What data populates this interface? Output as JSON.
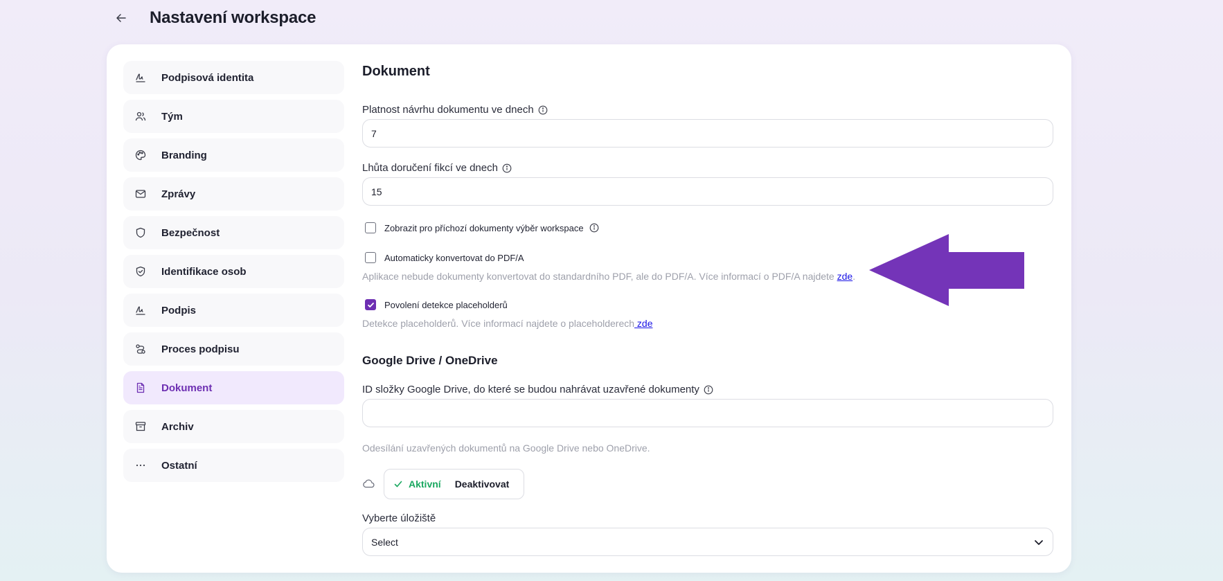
{
  "header": {
    "title": "Nastavení workspace"
  },
  "sidebar": {
    "items": [
      {
        "label": "Podpisová identita",
        "icon": "signature-icon",
        "active": false
      },
      {
        "label": "Tým",
        "icon": "users-icon",
        "active": false
      },
      {
        "label": "Branding",
        "icon": "palette-icon",
        "active": false
      },
      {
        "label": "Zprávy",
        "icon": "mail-icon",
        "active": false
      },
      {
        "label": "Bezpečnost",
        "icon": "shield-icon",
        "active": false
      },
      {
        "label": "Identifikace osob",
        "icon": "shield-check-icon",
        "active": false
      },
      {
        "label": "Podpis",
        "icon": "signature-icon",
        "active": false
      },
      {
        "label": "Proces podpisu",
        "icon": "route-icon",
        "active": false
      },
      {
        "label": "Dokument",
        "icon": "document-icon",
        "active": true
      },
      {
        "label": "Archiv",
        "icon": "archive-icon",
        "active": false
      },
      {
        "label": "Ostatní",
        "icon": "more-icon",
        "active": false
      }
    ]
  },
  "main": {
    "section_title": "Dokument",
    "validity": {
      "label": "Platnost návrhu dokumentu ve dnech",
      "value": "7"
    },
    "delivery": {
      "label": "Lhůta doručení fikcí ve dnech",
      "value": "15"
    },
    "show_workspace_choice": {
      "label": "Zobrazit pro příchozí dokumenty výběr workspace",
      "checked": false
    },
    "pdfa": {
      "label": "Automaticky konvertovat do PDF/A",
      "checked": false,
      "help": "Aplikace nebude dokumenty konvertovat do standardního PDF, ale do PDF/A. Více informací o PDF/A najdete ",
      "link": "zde",
      "help_end": "."
    },
    "placeholders": {
      "label": "Povolení detekce placeholderů",
      "checked": true,
      "help": "Detekce placeholderů. Více informací najdete o placeholderech",
      "link": " zde"
    },
    "drive": {
      "title": "Google Drive / OneDrive",
      "folder_label": "ID složky Google Drive, do které se budou nahrávat uzavřené dokumenty",
      "folder_value": "",
      "help": "Odesílání uzavřených dokumentů na Google Drive nebo OneDrive.",
      "active_label": "Aktivní",
      "deactivate_label": "Deaktivovat",
      "storage_label": "Vyberte úložiště",
      "storage_value": "Select"
    }
  },
  "colors": {
    "accent": "#6d2fb2",
    "active_green": "#1aa860",
    "link": "#1a14e6",
    "arrow": "#6d2fb2"
  }
}
